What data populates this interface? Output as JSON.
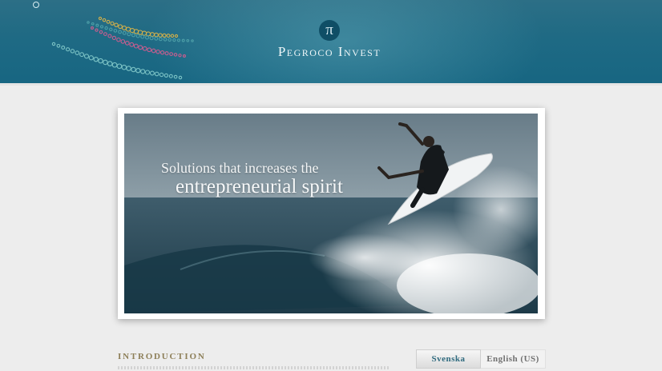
{
  "header": {
    "logo_symbol": "π",
    "brand": "Pegroco Invest",
    "decoration_icon": "dotted-feather-decoration-icon"
  },
  "hero": {
    "tagline_line1": "Solutions that increases the",
    "tagline_line2": "entrepreneurial spirit",
    "image": "surfer-on-wave-photo"
  },
  "content": {
    "section_title": "INTRODUCTION"
  },
  "language_switcher": {
    "options": [
      "Svenska",
      "English (US)"
    ],
    "active": "Svenska"
  },
  "colors": {
    "header_teal": "#1f6a84",
    "background": "#ededed",
    "heading_gold": "#8d7f58",
    "link_teal": "#2f6a7e"
  }
}
